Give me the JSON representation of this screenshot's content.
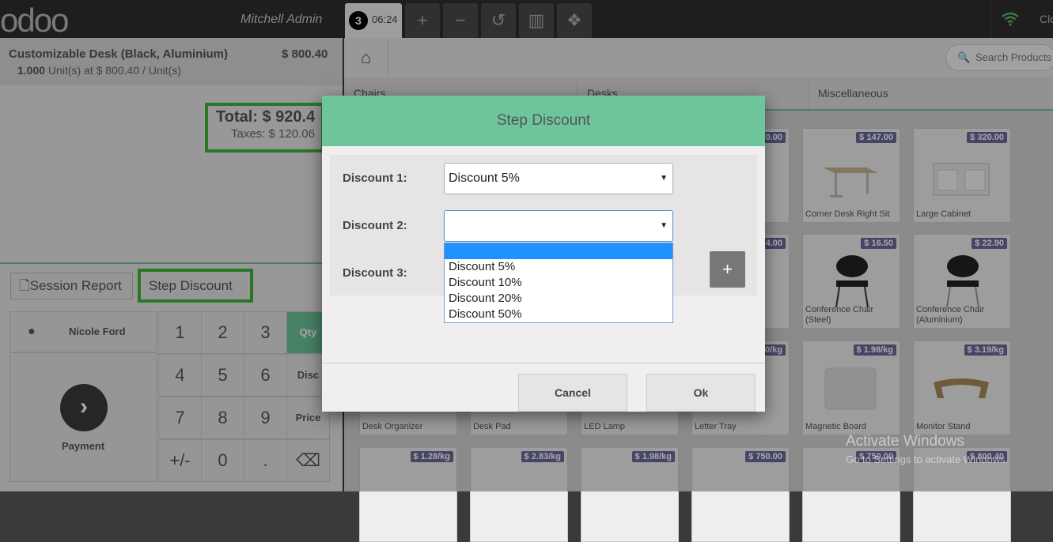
{
  "topbar": {
    "logo": "odoo",
    "user": "Mitchell Admin",
    "order_number": "3",
    "order_time": "06:24",
    "add_icon": "+",
    "remove_icon": "−",
    "history_icon": "↺",
    "chart_icon": "▥",
    "cubes_icon": "❖",
    "wifi_icon": "wifi-icon",
    "close_label": "Clo"
  },
  "order": {
    "product_name": "Customizable Desk (Black, Aluminium)",
    "product_price": "$ 800.40",
    "qty": "1.000",
    "qty_detail": "Unit(s) at $ 800.40 / Unit(s)",
    "total": "Total: $ 920.4",
    "taxes": "Taxes: $ 120.06"
  },
  "controls": {
    "session_report": "Session Report",
    "step_discount": "Step Discount"
  },
  "numpad": {
    "customer": "Nicole Ford",
    "payment": "Payment",
    "payment_icon": "›",
    "keys": [
      "1",
      "2",
      "3",
      "4",
      "5",
      "6",
      "7",
      "8",
      "9",
      "+/-",
      "0",
      "."
    ],
    "backspace": "⌫",
    "qty": "Qty",
    "disc": "Disc",
    "price": "Price"
  },
  "products_panel": {
    "search_placeholder": "Search Products",
    "categories": [
      "Chairs",
      "Desks",
      "Miscellaneous"
    ],
    "products": [
      {
        "price": "0.00",
        "name": ""
      },
      {
        "price": "$ 147.00",
        "name": "Corner Desk Right Sit"
      },
      {
        "price": "$ 320.00",
        "name": "Large Cabinet"
      },
      {
        "price": "4.00",
        "name": ""
      },
      {
        "price": "$ 16.50",
        "name": "Conference Chair (Steel)"
      },
      {
        "price": "$ 22.90",
        "name": "Conference Chair (Aluminium)"
      },
      {
        "price": "0/kg",
        "name": ""
      },
      {
        "price": "$ 1.98/kg",
        "name": "Magnetic Board"
      },
      {
        "price": "$ 3.19/kg",
        "name": "Monitor Stand"
      },
      {
        "price": "",
        "name": "Desk Organizer"
      },
      {
        "price": "",
        "name": "Desk Pad"
      },
      {
        "price": "",
        "name": "LED Lamp"
      },
      {
        "price": "",
        "name": "Letter Tray"
      },
      {
        "price": "$ 1.28/kg",
        "name": ""
      },
      {
        "price": "$ 2.83/kg",
        "name": ""
      },
      {
        "price": "$ 1.98/kg",
        "name": ""
      },
      {
        "price": "$ 750.00",
        "name": ""
      },
      {
        "price": "$ 750.00",
        "name": ""
      },
      {
        "price": "$ 800.40",
        "name": ""
      }
    ]
  },
  "watermark": {
    "line1": "Activate Windows",
    "line2": "Go to Settings to activate Windows."
  },
  "modal": {
    "title": "Step Discount",
    "discount1_label": "Discount 1:",
    "discount1_value": "Discount 5%",
    "discount2_label": "Discount 2:",
    "discount2_value": "",
    "discount3_label": "Discount 3:",
    "options": [
      "",
      "Discount 5%",
      "Discount 10%",
      "Discount 20%",
      "Discount 50%"
    ],
    "add_icon": "+",
    "cancel": "Cancel",
    "ok": "Ok"
  },
  "colors": {
    "accent_green": "#6ec49b",
    "highlight_green": "#3cb83c",
    "price_tag": "#6b6a9c",
    "dropdown_highlight": "#1e90ff"
  }
}
